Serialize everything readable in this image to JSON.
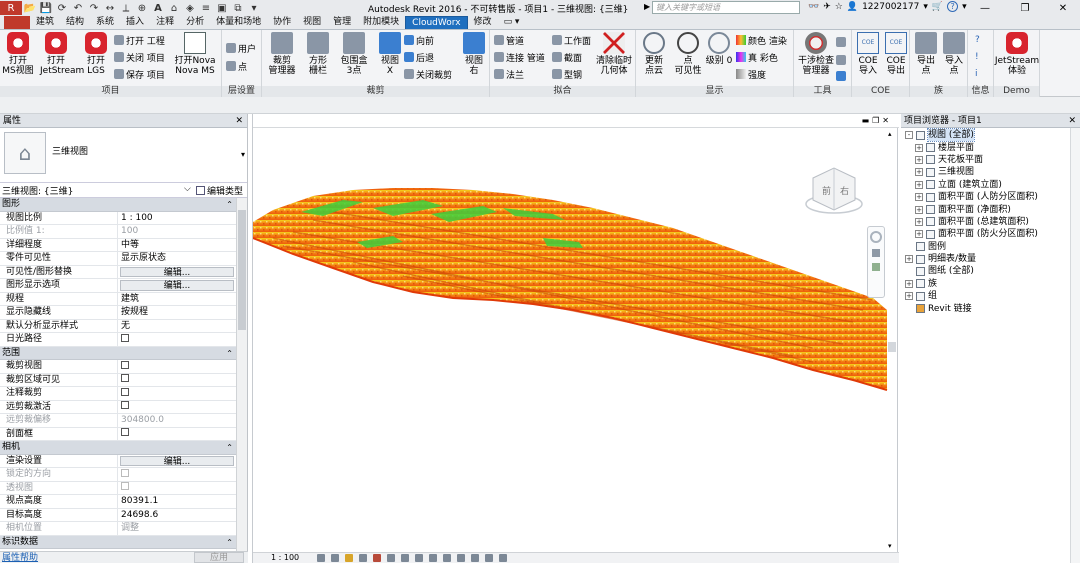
{
  "titlebar": {
    "app_title": "Autodesk Revit 2016 - 不可转售版 -    项目1 - 三维视图: {三维}",
    "search_placeholder": "键入关键字或短语",
    "user_name": "1227002177",
    "help_icon": "?",
    "win_min": "—",
    "win_restore": "❐",
    "win_close": "✕"
  },
  "ribbon_tabs": [
    "建筑",
    "结构",
    "系统",
    "插入",
    "注释",
    "分析",
    "体量和场地",
    "协作",
    "视图",
    "管理",
    "附加模块",
    "CloudWorx",
    "修改"
  ],
  "active_tab": "CloudWorx",
  "ribbon": {
    "groups": {
      "project": "项目",
      "layer": "层设置",
      "crop": "裁剪",
      "fit": "拟合",
      "display": "显示",
      "tools": "工具",
      "coe": "COE",
      "family": "族",
      "info": "信息",
      "demo": "Demo"
    },
    "buttons": {
      "open_ms": "打开\nMS视图",
      "jetstream": "打开\nJetStream",
      "open_lgs": "打开\nLGS",
      "open_project": "打开 工程",
      "close_project": "关闭 项目",
      "save_project": "保存 项目",
      "open_nova": "打开Nova\nNova MS",
      "user": "用户",
      "point": "点",
      "crop_manager": "裁剪\n管理器",
      "square_fence": "方形\n栅栏",
      "bbox3": "包围盒\n3点",
      "view_x": "视图\nX",
      "forward": "向前",
      "backward": "后退",
      "close_crop": "关闭裁剪",
      "view_right": "视图\n右",
      "pipe": "管道",
      "connect_pipe": "连接 管道",
      "flange": "法兰",
      "workface": "工作面",
      "section": "截面",
      "steel": "型钢",
      "clear_temp": "清除临时\n几何体",
      "update_cloud": "更新\n点云",
      "point_visibility": "点\n可见性",
      "level0": "级别 0",
      "color_render": "颜色 渲染",
      "true_color": "真 彩色",
      "intensity": "强度",
      "clash_manager": "干涉检查\n管理器",
      "coe_import": "COE\n导入",
      "coe_export": "COE\n导出",
      "export_point": "导出\n点",
      "import_point": "导入\n点",
      "jetstream_exp": "JetStream\n体验"
    }
  },
  "properties": {
    "header": "属性",
    "type_name": "三维视图",
    "instance_selector": "三维视图: {三维}",
    "edit_type": "编辑类型",
    "help": "属性帮助",
    "apply": "应用",
    "sections": [
      {
        "name": "图形",
        "rows": [
          {
            "n": "视图比例",
            "v": "1 : 100"
          },
          {
            "n": "比例值 1:",
            "v": "100",
            "dis": true
          },
          {
            "n": "详细程度",
            "v": "中等"
          },
          {
            "n": "零件可见性",
            "v": "显示原状态"
          },
          {
            "n": "可见性/图形替换",
            "v": "编辑...",
            "btn": true
          },
          {
            "n": "图形显示选项",
            "v": "编辑...",
            "btn": true
          },
          {
            "n": "规程",
            "v": "建筑"
          },
          {
            "n": "显示隐藏线",
            "v": "按规程"
          },
          {
            "n": "默认分析显示样式",
            "v": "无"
          },
          {
            "n": "日光路径",
            "v": "",
            "cb": true
          }
        ]
      },
      {
        "name": "范围",
        "rows": [
          {
            "n": "裁剪视图",
            "v": "",
            "cb": true
          },
          {
            "n": "裁剪区域可见",
            "v": "",
            "cb": true
          },
          {
            "n": "注释裁剪",
            "v": "",
            "cb": true
          },
          {
            "n": "远剪裁激活",
            "v": "",
            "cb": true
          },
          {
            "n": "远剪裁偏移",
            "v": "304800.0",
            "dis": true
          },
          {
            "n": "剖面框",
            "v": "",
            "cb": true
          }
        ]
      },
      {
        "name": "相机",
        "rows": [
          {
            "n": "渲染设置",
            "v": "编辑...",
            "btn": true
          },
          {
            "n": "锁定的方向",
            "v": "",
            "cb": true,
            "dis": true
          },
          {
            "n": "透视图",
            "v": "",
            "cb": true,
            "dis": true
          },
          {
            "n": "视点高度",
            "v": "80391.1"
          },
          {
            "n": "目标高度",
            "v": "24698.6"
          },
          {
            "n": "相机位置",
            "v": "调整",
            "dis": true
          }
        ]
      },
      {
        "name": "标识数据",
        "rows": []
      }
    ]
  },
  "viewport": {
    "scale": "1 : 100",
    "cube_front": "前",
    "cube_right": "右"
  },
  "browser": {
    "header": "项目浏览器 - 项目1",
    "nodes": [
      {
        "label": "视图 (全部)",
        "depth": 0,
        "exp": "-",
        "sel": true
      },
      {
        "label": "楼层平面",
        "depth": 1,
        "exp": "+"
      },
      {
        "label": "天花板平面",
        "depth": 1,
        "exp": "+"
      },
      {
        "label": "三维视图",
        "depth": 1,
        "exp": "+"
      },
      {
        "label": "立面 (建筑立面)",
        "depth": 1,
        "exp": "+"
      },
      {
        "label": "面积平面 (人防分区面积)",
        "depth": 1,
        "exp": "+"
      },
      {
        "label": "面积平面 (净面积)",
        "depth": 1,
        "exp": "+"
      },
      {
        "label": "面积平面 (总建筑面积)",
        "depth": 1,
        "exp": "+"
      },
      {
        "label": "面积平面 (防火分区面积)",
        "depth": 1,
        "exp": "+"
      },
      {
        "label": "图例",
        "depth": 0,
        "exp": ""
      },
      {
        "label": "明细表/数量",
        "depth": 0,
        "exp": "+"
      },
      {
        "label": "图纸 (全部)",
        "depth": 0,
        "exp": ""
      },
      {
        "label": "族",
        "depth": 0,
        "exp": "+"
      },
      {
        "label": "组",
        "depth": 0,
        "exp": "+"
      },
      {
        "label": "Revit 链接",
        "depth": 0,
        "exp": ""
      }
    ]
  },
  "colors": {
    "active_tab": "#1f6fbf",
    "revit_red": "#d8242e",
    "cloud_orange": "#f07a10",
    "cloud_yellow": "#f2c21a",
    "cloud_green": "#3fcf3c"
  }
}
